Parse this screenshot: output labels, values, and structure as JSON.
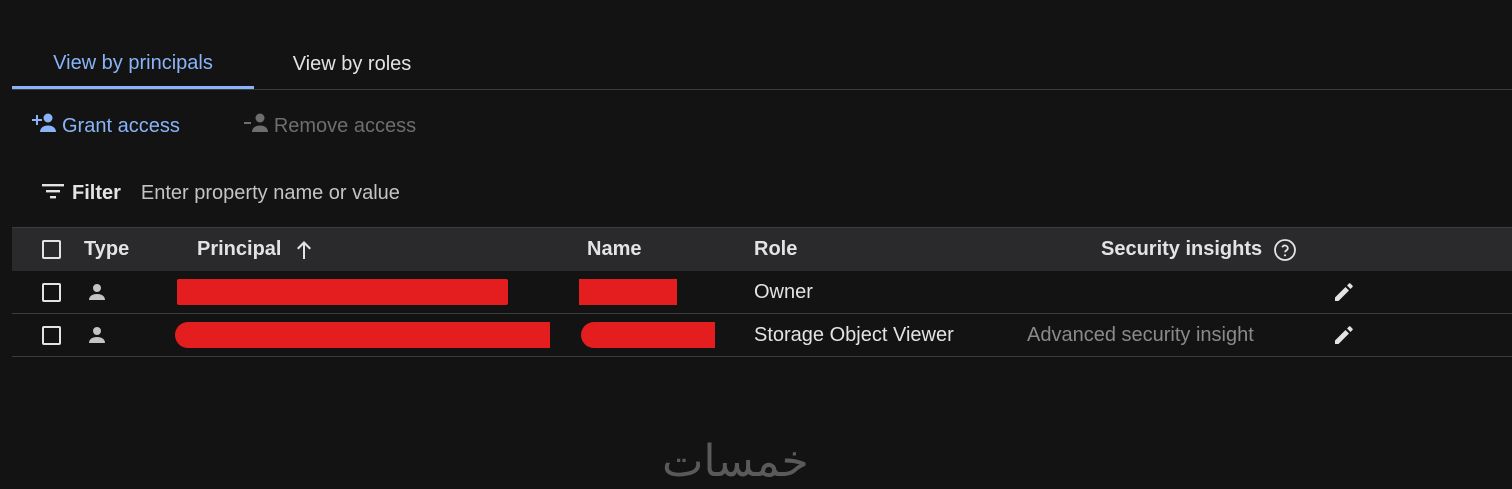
{
  "tabs": [
    {
      "label": "View by principals",
      "active": true
    },
    {
      "label": "View by roles",
      "active": false
    }
  ],
  "actions": {
    "grant_label": "Grant access",
    "remove_label": "Remove access"
  },
  "filter": {
    "label": "Filter",
    "placeholder": "Enter property name or value"
  },
  "table": {
    "columns": {
      "type": "Type",
      "principal": "Principal",
      "name": "Name",
      "role": "Role",
      "security_insights": "Security insights"
    },
    "sort": {
      "column": "principal",
      "direction": "ascending"
    },
    "rows": [
      {
        "type_icon": "person-icon",
        "principal": "[redacted]",
        "name": "[redacted]",
        "role": "Owner",
        "security_insight": ""
      },
      {
        "type_icon": "person-icon",
        "principal": "[redacted]",
        "name": "[redacted]",
        "role": "Storage Object Viewer",
        "security_insight": "Advanced security insight"
      }
    ]
  },
  "icons": {
    "grant": "add-person-icon",
    "remove": "remove-person-icon",
    "filter": "filter-icon",
    "sort": "arrow-up-icon",
    "help": "help-circle-icon",
    "edit": "pencil-icon",
    "type": "person-icon"
  },
  "colors": {
    "accent": "#8ab4f8",
    "background": "#131313",
    "header_background": "#2a2a2c",
    "redaction": "#e41e1e",
    "disabled_text": "#6e6e6e"
  },
  "watermark": "خمسات"
}
